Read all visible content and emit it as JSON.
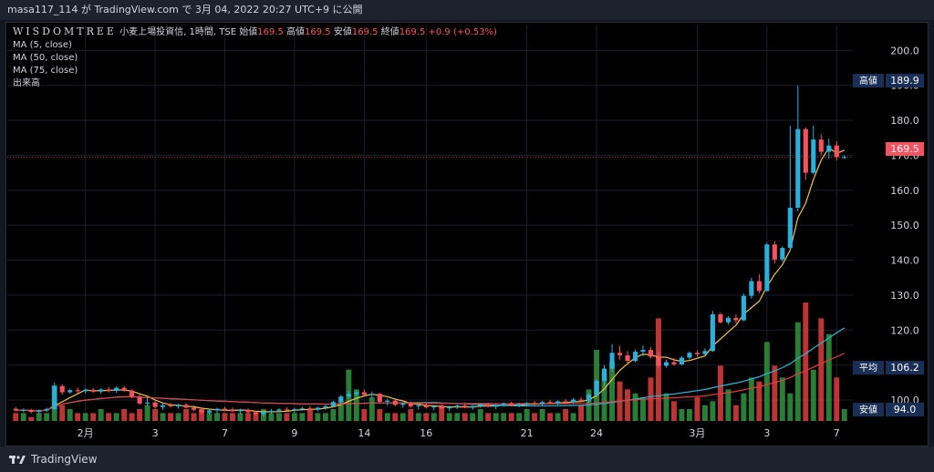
{
  "header": {
    "publish_text": "masa117_114 が TradingView.com で 3月 04, 2022 20:27 UTC+9 に公開"
  },
  "legend": {
    "symbol": "WISDOMTREE",
    "description": "小麦上場投資信, 1時間, TSE",
    "open_label": "始値",
    "open_value": "169.5",
    "high_label": "高値",
    "high_value": "169.5",
    "low_label": "安値",
    "low_value": "169.5",
    "close_label": "終値",
    "close_value": "169.5",
    "change": "+0.9 (+0.53%)",
    "ma5": "MA (5, close)",
    "ma50": "MA (50, close)",
    "ma75": "MA (75, close)",
    "volume": "出来高"
  },
  "price_labels": {
    "high_tag": "高値",
    "high_value": "189.9",
    "last_value": "169.5",
    "avg_tag": "平均",
    "avg_value": "106.2",
    "low_tag": "安値",
    "low_value": "94.0"
  },
  "footer": {
    "brand": "TradingView"
  },
  "colors": {
    "up": "#26a69a",
    "down": "#f7525f",
    "candle_up": "#2ab0dd",
    "ma5": "#f5c242",
    "ma50": "#29b6d8",
    "ma75": "#e23c3c",
    "vol_up": "#2e8b3a",
    "vol_down": "#d23a3a",
    "tag_bg": "#1a2f55",
    "last_bg": "#f7525f"
  },
  "chart_data": {
    "type": "candlestick",
    "y_axis_ticks": [
      "200.0",
      "190.0",
      "180.0",
      "170.0",
      "160.0",
      "150.0",
      "140.0",
      "130.0",
      "120.0",
      "110.0",
      "100.0"
    ],
    "ylim": [
      94,
      204
    ],
    "x_axis_ticks": [
      {
        "label": "2月",
        "index": 9
      },
      {
        "label": "3",
        "index": 18
      },
      {
        "label": "7",
        "index": 27
      },
      {
        "label": "9",
        "index": 36
      },
      {
        "label": "14",
        "index": 45
      },
      {
        "label": "16",
        "index": 53
      },
      {
        "label": "21",
        "index": 66
      },
      {
        "label": "24",
        "index": 75
      },
      {
        "label": "3月",
        "index": 88
      },
      {
        "label": "3",
        "index": 97
      },
      {
        "label": "7",
        "index": 106
      }
    ],
    "bar_count": 108,
    "ohlc": [
      [
        97.5,
        98.0,
        96.8,
        97.0
      ],
      [
        97.0,
        97.6,
        96.5,
        97.2
      ],
      [
        97.2,
        97.5,
        96.2,
        96.6
      ],
      [
        96.6,
        97.3,
        96.0,
        97.0
      ],
      [
        97.0,
        97.8,
        96.6,
        97.4
      ],
      [
        97.4,
        105.0,
        97.0,
        104.0
      ],
      [
        104.0,
        104.5,
        101.5,
        102.2
      ],
      [
        102.2,
        103.2,
        101.8,
        102.8
      ],
      [
        102.8,
        103.6,
        102.0,
        102.5
      ],
      [
        102.5,
        103.3,
        101.9,
        102.9
      ],
      [
        102.9,
        103.5,
        102.1,
        102.4
      ],
      [
        102.4,
        103.4,
        101.8,
        103.0
      ],
      [
        103.0,
        103.8,
        102.2,
        102.6
      ],
      [
        102.6,
        103.9,
        102.0,
        103.5
      ],
      [
        103.5,
        104.1,
        102.3,
        102.7
      ],
      [
        102.7,
        103.0,
        100.5,
        101.0
      ],
      [
        101.0,
        101.6,
        98.6,
        99.0
      ],
      [
        99.0,
        100.8,
        98.3,
        99.3
      ],
      [
        99.3,
        99.8,
        97.5,
        98.0
      ],
      [
        98.0,
        99.0,
        97.2,
        98.5
      ],
      [
        98.5,
        99.2,
        97.8,
        98.2
      ],
      [
        98.2,
        98.9,
        97.5,
        98.6
      ],
      [
        98.6,
        99.1,
        97.6,
        97.8
      ],
      [
        97.8,
        98.4,
        96.8,
        97.2
      ],
      [
        97.2,
        97.9,
        96.0,
        96.4
      ],
      [
        96.4,
        97.4,
        95.8,
        97.0
      ],
      [
        97.0,
        97.8,
        96.2,
        97.5
      ],
      [
        97.5,
        98.0,
        96.8,
        97.3
      ],
      [
        97.3,
        97.9,
        96.5,
        96.8
      ],
      [
        96.8,
        97.5,
        96.0,
        97.2
      ],
      [
        97.2,
        97.6,
        96.2,
        96.5
      ],
      [
        96.5,
        97.0,
        95.6,
        96.0
      ],
      [
        96.0,
        96.9,
        95.2,
        96.6
      ],
      [
        96.6,
        97.4,
        96.0,
        96.9
      ],
      [
        96.9,
        97.6,
        96.4,
        97.3
      ],
      [
        97.3,
        97.9,
        96.8,
        97.0
      ],
      [
        97.0,
        97.7,
        96.3,
        97.4
      ],
      [
        97.4,
        98.0,
        96.9,
        97.6
      ],
      [
        97.6,
        98.3,
        97.0,
        97.2
      ],
      [
        97.2,
        98.0,
        96.8,
        97.8
      ],
      [
        97.8,
        98.6,
        97.2,
        98.2
      ],
      [
        98.2,
        99.8,
        97.9,
        99.4
      ],
      [
        99.4,
        101.5,
        99.0,
        101.0
      ],
      [
        101.0,
        102.5,
        100.5,
        101.7
      ],
      [
        101.7,
        102.8,
        101.0,
        102.2
      ],
      [
        102.2,
        103.0,
        101.2,
        101.5
      ],
      [
        101.5,
        102.4,
        100.6,
        101.8
      ],
      [
        101.8,
        102.0,
        99.0,
        99.5
      ],
      [
        99.5,
        100.4,
        98.4,
        99.8
      ],
      [
        99.8,
        100.2,
        98.2,
        98.6
      ],
      [
        98.6,
        99.4,
        97.8,
        99.0
      ],
      [
        99.0,
        99.6,
        97.8,
        98.2
      ],
      [
        98.2,
        98.9,
        97.2,
        98.5
      ],
      [
        98.5,
        99.1,
        97.6,
        97.9
      ],
      [
        97.9,
        98.6,
        97.0,
        98.2
      ],
      [
        98.2,
        98.8,
        97.4,
        97.6
      ],
      [
        97.6,
        98.4,
        96.8,
        98.0
      ],
      [
        98.0,
        98.7,
        97.4,
        98.4
      ],
      [
        98.4,
        98.9,
        97.6,
        97.8
      ],
      [
        97.8,
        98.5,
        97.2,
        98.3
      ],
      [
        98.3,
        99.0,
        97.8,
        98.7
      ],
      [
        98.7,
        99.2,
        97.9,
        98.1
      ],
      [
        98.1,
        98.8,
        97.4,
        98.5
      ],
      [
        98.5,
        99.3,
        98.0,
        99.0
      ],
      [
        99.0,
        99.5,
        98.2,
        98.4
      ],
      [
        98.4,
        99.2,
        97.9,
        98.8
      ],
      [
        98.8,
        99.4,
        98.3,
        99.1
      ],
      [
        99.1,
        99.7,
        98.5,
        98.9
      ],
      [
        98.9,
        99.8,
        98.4,
        99.4
      ],
      [
        99.4,
        100.0,
        98.8,
        99.0
      ],
      [
        99.0,
        99.9,
        98.6,
        99.6
      ],
      [
        99.6,
        100.2,
        99.0,
        99.3
      ],
      [
        99.3,
        100.5,
        99.0,
        100.1
      ],
      [
        100.1,
        100.8,
        99.5,
        99.8
      ],
      [
        99.8,
        102.0,
        99.2,
        101.5
      ],
      [
        101.5,
        106.0,
        101.0,
        105.5
      ],
      [
        105.5,
        110.0,
        104.0,
        109.0
      ],
      [
        109.0,
        116.0,
        108.0,
        113.5
      ],
      [
        113.5,
        115.5,
        111.5,
        112.8
      ],
      [
        112.8,
        114.0,
        110.0,
        111.2
      ],
      [
        111.2,
        114.5,
        110.8,
        113.8
      ],
      [
        113.8,
        115.6,
        112.5,
        114.3
      ],
      [
        114.3,
        115.2,
        111.8,
        112.4
      ],
      [
        112.4,
        113.8,
        109.0,
        109.8
      ],
      [
        109.8,
        111.5,
        109.2,
        110.8
      ],
      [
        110.8,
        112.0,
        109.8,
        110.2
      ],
      [
        110.2,
        112.6,
        110.0,
        112.1
      ],
      [
        112.1,
        113.9,
        111.6,
        113.5
      ],
      [
        113.5,
        114.2,
        112.4,
        113.1
      ],
      [
        113.1,
        114.8,
        112.8,
        114.0
      ],
      [
        114.0,
        125.5,
        113.8,
        124.5
      ],
      [
        124.5,
        125.0,
        121.8,
        122.2
      ],
      [
        122.2,
        124.0,
        121.5,
        123.5
      ],
      [
        123.5,
        124.5,
        122.0,
        122.8
      ],
      [
        122.8,
        130.5,
        122.5,
        129.8
      ],
      [
        129.8,
        135.0,
        129.0,
        134.0
      ],
      [
        134.0,
        136.0,
        130.5,
        131.2
      ],
      [
        131.2,
        145.0,
        131.0,
        144.5
      ],
      [
        144.5,
        145.5,
        139.0,
        140.2
      ],
      [
        140.2,
        144.0,
        139.5,
        143.5
      ],
      [
        143.5,
        178.5,
        143.0,
        155.0
      ],
      [
        155.0,
        190.0,
        154.0,
        177.5
      ],
      [
        177.5,
        178.0,
        163.0,
        165.0
      ],
      [
        165.0,
        178.5,
        164.5,
        174.5
      ],
      [
        174.5,
        176.0,
        170.0,
        171.0
      ],
      [
        171.0,
        174.8,
        169.0,
        172.8
      ],
      [
        172.8,
        174.0,
        168.5,
        169.5
      ],
      [
        169.5,
        170.0,
        169.0,
        169.5
      ]
    ],
    "volume": [
      2,
      2,
      1,
      2,
      2,
      9,
      4,
      3,
      2,
      2,
      2,
      3,
      2,
      2,
      3,
      2,
      3,
      4,
      3,
      2,
      2,
      2,
      3,
      2,
      3,
      2,
      2,
      2,
      2,
      2,
      2,
      2,
      3,
      2,
      2,
      2,
      2,
      2,
      3,
      2,
      2,
      3,
      5,
      13,
      8,
      3,
      6,
      3,
      2,
      2,
      2,
      3,
      2,
      2,
      2,
      4,
      2,
      2,
      2,
      2,
      3,
      2,
      2,
      2,
      2,
      2,
      3,
      2,
      3,
      2,
      2,
      3,
      2,
      4,
      8,
      18,
      12,
      15,
      10,
      8,
      7,
      6,
      11,
      26,
      7,
      5,
      3,
      3,
      6,
      4,
      5,
      14,
      8,
      4,
      7,
      11,
      10,
      20,
      14,
      11,
      7,
      25,
      30,
      13,
      26,
      22,
      11,
      3
    ],
    "volume_max": 30
  }
}
